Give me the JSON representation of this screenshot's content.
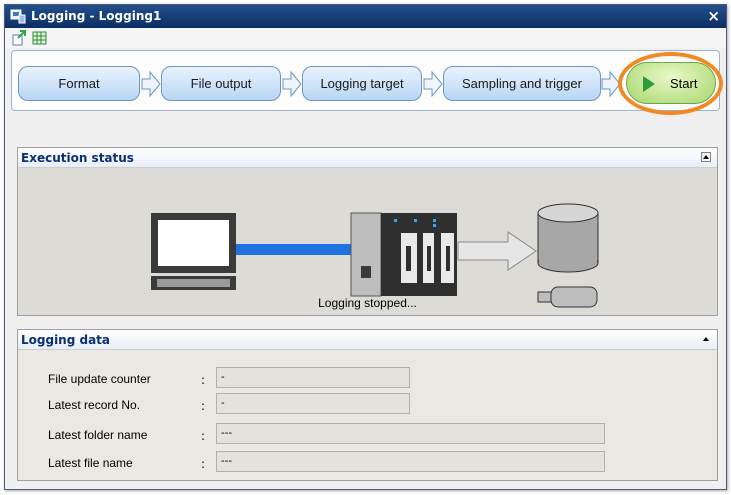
{
  "window": {
    "title": "Logging - Logging1",
    "close_label": "×"
  },
  "toolbar": {
    "items": [
      {
        "icon": "import-arrow-icon"
      },
      {
        "icon": "grid-table-icon"
      }
    ]
  },
  "flow": {
    "steps": [
      {
        "label": "Format"
      },
      {
        "label": "File output"
      },
      {
        "label": "Logging target"
      },
      {
        "label": "Sampling and trigger"
      }
    ],
    "start_label": "Start"
  },
  "execution": {
    "header": "Execution status",
    "status_text": "Logging stopped..."
  },
  "logging_data": {
    "header": "Logging data",
    "rows": [
      {
        "label": "File update counter",
        "colon": ":",
        "value": "-"
      },
      {
        "label": "Latest record No.",
        "colon": ":",
        "value": "-"
      },
      {
        "label": "Latest folder name",
        "colon": ":",
        "value": "---"
      },
      {
        "label": "Latest file name",
        "colon": ":",
        "value": "---"
      }
    ]
  },
  "colors": {
    "title_bar": "#0c2e63",
    "accent_orange": "#f08a23",
    "panel_header_text": "#0b2f74"
  }
}
